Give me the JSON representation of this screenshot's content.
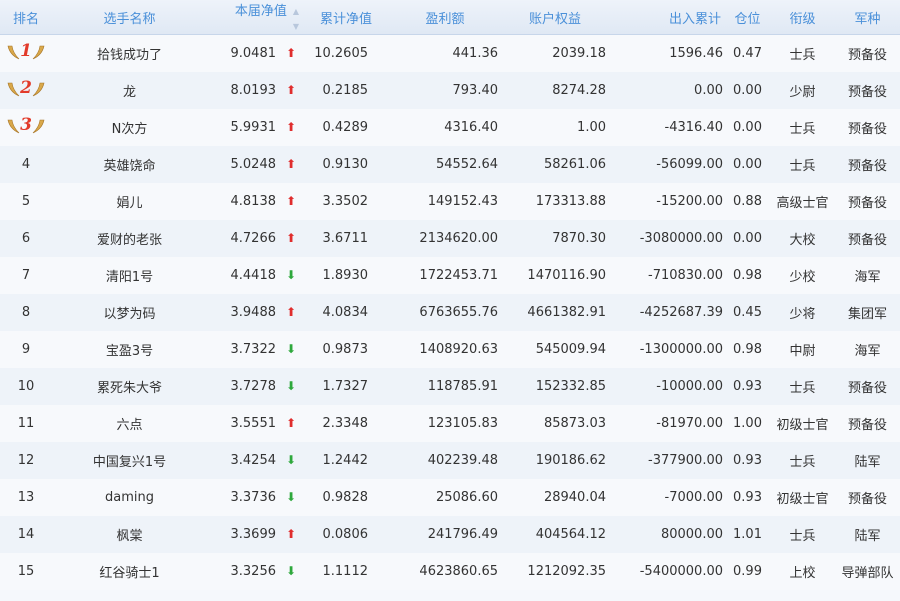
{
  "columns": [
    "排名",
    "选手名称",
    "本届净值",
    "累计净值",
    "盈利额",
    "账户权益",
    "出入累计",
    "仓位",
    "衔级",
    "军种"
  ],
  "sort_icon": "sort-updown-icon",
  "colors": {
    "header_text": "#4a90d9",
    "up_arrow": "#e02d2d",
    "down_arrow": "#2ea83c",
    "rank_number": "#e23a2a"
  },
  "rows": [
    {
      "rank": "1",
      "medal": true,
      "name": "拾钱成功了",
      "nav": "9.0481",
      "trend": "up",
      "cum_nav": "10.2605",
      "profit": "441.36",
      "equity": "2039.18",
      "flow": "1596.46",
      "position": "0.47",
      "rank_title": "士兵",
      "branch": "预备役"
    },
    {
      "rank": "2",
      "medal": true,
      "name": "龙",
      "nav": "8.0193",
      "trend": "up",
      "cum_nav": "0.2185",
      "profit": "793.40",
      "equity": "8274.28",
      "flow": "0.00",
      "position": "0.00",
      "rank_title": "少尉",
      "branch": "预备役"
    },
    {
      "rank": "3",
      "medal": true,
      "name": "N次方",
      "nav": "5.9931",
      "trend": "up",
      "cum_nav": "0.4289",
      "profit": "4316.40",
      "equity": "1.00",
      "flow": "-4316.40",
      "position": "0.00",
      "rank_title": "士兵",
      "branch": "预备役"
    },
    {
      "rank": "4",
      "medal": false,
      "name": "英雄饶命",
      "nav": "5.0248",
      "trend": "up",
      "cum_nav": "0.9130",
      "profit": "54552.64",
      "equity": "58261.06",
      "flow": "-56099.00",
      "position": "0.00",
      "rank_title": "士兵",
      "branch": "预备役"
    },
    {
      "rank": "5",
      "medal": false,
      "name": "娟儿",
      "nav": "4.8138",
      "trend": "up",
      "cum_nav": "3.3502",
      "profit": "149152.43",
      "equity": "173313.88",
      "flow": "-15200.00",
      "position": "0.88",
      "rank_title": "高级士官",
      "branch": "预备役"
    },
    {
      "rank": "6",
      "medal": false,
      "name": "爱财的老张",
      "nav": "4.7266",
      "trend": "up",
      "cum_nav": "3.6711",
      "profit": "2134620.00",
      "equity": "7870.30",
      "flow": "-3080000.00",
      "position": "0.00",
      "rank_title": "大校",
      "branch": "预备役"
    },
    {
      "rank": "7",
      "medal": false,
      "name": "清阳1号",
      "nav": "4.4418",
      "trend": "down",
      "cum_nav": "1.8930",
      "profit": "1722453.71",
      "equity": "1470116.90",
      "flow": "-710830.00",
      "position": "0.98",
      "rank_title": "少校",
      "branch": "海军"
    },
    {
      "rank": "8",
      "medal": false,
      "name": "以梦为码",
      "nav": "3.9488",
      "trend": "up",
      "cum_nav": "4.0834",
      "profit": "6763655.76",
      "equity": "4661382.91",
      "flow": "-4252687.39",
      "position": "0.45",
      "rank_title": "少将",
      "branch": "集团军"
    },
    {
      "rank": "9",
      "medal": false,
      "name": "宝盈3号",
      "nav": "3.7322",
      "trend": "down",
      "cum_nav": "0.9873",
      "profit": "1408920.63",
      "equity": "545009.94",
      "flow": "-1300000.00",
      "position": "0.98",
      "rank_title": "中尉",
      "branch": "海军"
    },
    {
      "rank": "10",
      "medal": false,
      "name": "累死朱大爷",
      "nav": "3.7278",
      "trend": "down",
      "cum_nav": "1.7327",
      "profit": "118785.91",
      "equity": "152332.85",
      "flow": "-10000.00",
      "position": "0.93",
      "rank_title": "士兵",
      "branch": "预备役"
    },
    {
      "rank": "11",
      "medal": false,
      "name": "六点",
      "nav": "3.5551",
      "trend": "up",
      "cum_nav": "2.3348",
      "profit": "123105.83",
      "equity": "85873.03",
      "flow": "-81970.00",
      "position": "1.00",
      "rank_title": "初级士官",
      "branch": "预备役"
    },
    {
      "rank": "12",
      "medal": false,
      "name": "中国复兴1号",
      "nav": "3.4254",
      "trend": "down",
      "cum_nav": "1.2442",
      "profit": "402239.48",
      "equity": "190186.62",
      "flow": "-377900.00",
      "position": "0.93",
      "rank_title": "士兵",
      "branch": "陆军"
    },
    {
      "rank": "13",
      "medal": false,
      "name": "daming",
      "nav": "3.3736",
      "trend": "down",
      "cum_nav": "0.9828",
      "profit": "25086.60",
      "equity": "28940.04",
      "flow": "-7000.00",
      "position": "0.93",
      "rank_title": "初级士官",
      "branch": "预备役"
    },
    {
      "rank": "14",
      "medal": false,
      "name": "枫棠",
      "nav": "3.3699",
      "trend": "up",
      "cum_nav": "0.0806",
      "profit": "241796.49",
      "equity": "404564.12",
      "flow": "80000.00",
      "position": "1.01",
      "rank_title": "士兵",
      "branch": "陆军"
    },
    {
      "rank": "15",
      "medal": false,
      "name": "红谷骑士1",
      "nav": "3.3256",
      "trend": "down",
      "cum_nav": "1.1112",
      "profit": "4623860.65",
      "equity": "1212092.35",
      "flow": "-5400000.00",
      "position": "0.99",
      "rank_title": "上校",
      "branch": "导弹部队"
    }
  ]
}
